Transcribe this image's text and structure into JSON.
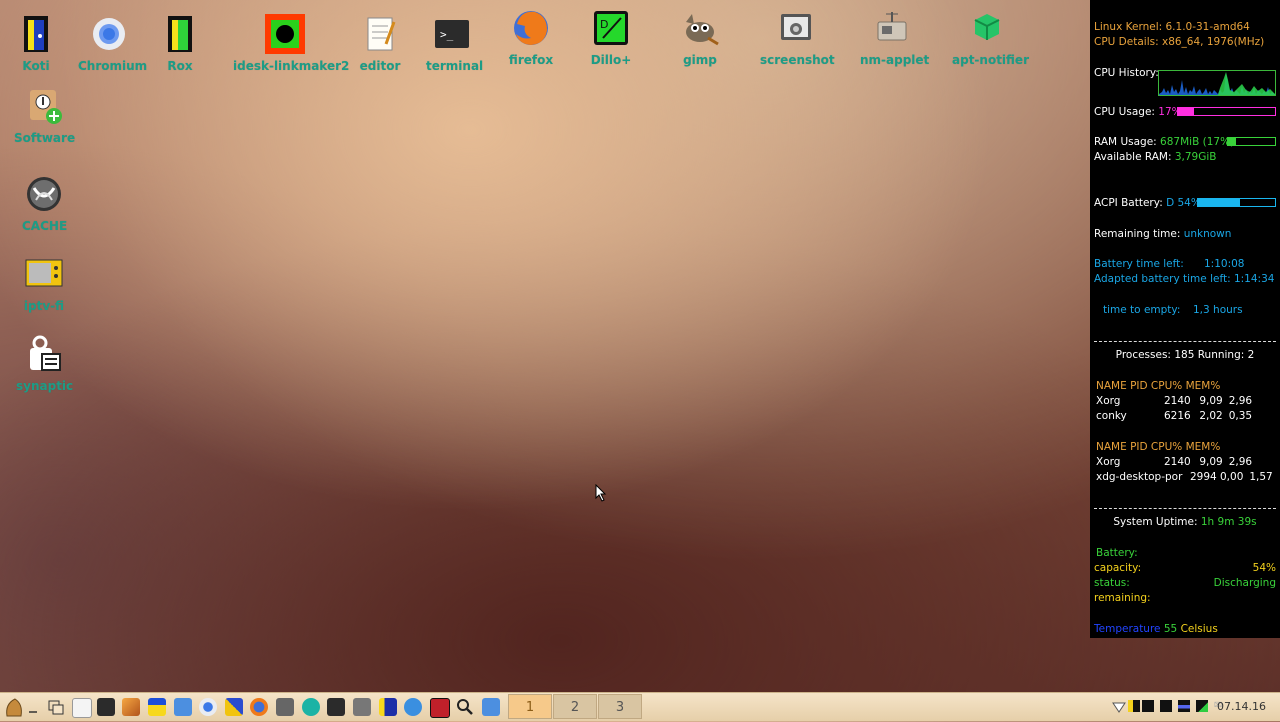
{
  "desktop": {
    "top_icons": [
      {
        "label": "Koti",
        "icon": "door-icon"
      },
      {
        "label": "Chromium",
        "icon": "chromium-icon"
      },
      {
        "label": "Rox",
        "icon": "rox-door-icon"
      },
      {
        "label": "idesk-linkmaker2",
        "icon": "linkmaker-icon"
      },
      {
        "label": "editor",
        "icon": "notepad-icon"
      },
      {
        "label": "terminal",
        "icon": "terminal-icon"
      },
      {
        "label": "firefox",
        "icon": "firefox-icon"
      },
      {
        "label": "Dillo+",
        "icon": "dillo-icon"
      },
      {
        "label": "gimp",
        "icon": "gimp-icon"
      },
      {
        "label": "screenshot",
        "icon": "camera-icon"
      },
      {
        "label": "nm-applet",
        "icon": "network-icon"
      },
      {
        "label": "apt-notifier",
        "icon": "package-icon"
      }
    ],
    "left_icons": [
      {
        "label": "Software",
        "icon": "software-install-icon"
      },
      {
        "label": "CACHE",
        "icon": "cache-icon"
      },
      {
        "label": "iptv-fi",
        "icon": "tv-icon"
      },
      {
        "label": "synaptic",
        "icon": "synaptic-icon"
      }
    ]
  },
  "conky": {
    "kernel_label": "Linux Kernel:",
    "kernel": "6.1.0-31-amd64",
    "cpu_details_label": "CPU Details:",
    "cpu_details": "x86_64, 1976(MHz)",
    "cpu_history_label": "CPU History:",
    "cpu_usage_label": "CPU Usage:",
    "cpu_usage": "17%",
    "cpu_usage_fraction": 0.17,
    "ram_usage_label": "RAM Usage:",
    "ram_usage": "687MiB (17%)",
    "ram_usage_fraction": 0.17,
    "available_ram_label": "Available RAM:",
    "available_ram": "3,79GiB",
    "acpi_battery_label": "ACPI Battery:",
    "acpi_battery": "D 54%",
    "battery_fraction": 0.54,
    "remaining_time_label": "Remaining time:",
    "remaining_time": "unknown",
    "battery_time_left_label": "Battery time left:",
    "battery_time_left": "1:10:08",
    "adapted_time_left_label": "Adapted battery time left:",
    "adapted_time_left": "1:14:34",
    "time_to_empty_label": "time to empty:",
    "time_to_empty": "1,3 hours",
    "processes_label": "Processes:",
    "processes": "185",
    "running_label": "Running:",
    "running": "2",
    "proc_header": "NAME PID CPU% MEM%",
    "cpu_table": [
      {
        "name": "Xorg",
        "pid": "2140",
        "cpu": "9,09",
        "mem": "2,96"
      },
      {
        "name": "conky",
        "pid": "6216",
        "cpu": "2,02",
        "mem": "0,35"
      }
    ],
    "mem_table": [
      {
        "name": "Xorg",
        "pid": "2140",
        "cpu": "9,09",
        "mem": "2,96"
      },
      {
        "name": "xdg-desktop-por",
        "pid": "2994",
        "cpu": "0,00",
        "mem": "1,57"
      }
    ],
    "uptime_label": "System Uptime:",
    "uptime": "1h 9m 39s",
    "battery_label": "Battery:",
    "capacity_label": "capacity:",
    "capacity": "54%",
    "status_label": "status:",
    "status": "Discharging",
    "remaining_label": "remaining:",
    "temperature_label": "Temperature",
    "temperature_value": "55",
    "temperature_unit": "Celsius"
  },
  "taskbar": {
    "workspaces": [
      "1",
      "2",
      "3"
    ],
    "active_workspace": "1",
    "clock": "07.14.16"
  },
  "colors": {
    "icon_label": "#1d9c86",
    "conky_bg": "#000000",
    "taskbar_bg": "#f5e4c8"
  }
}
